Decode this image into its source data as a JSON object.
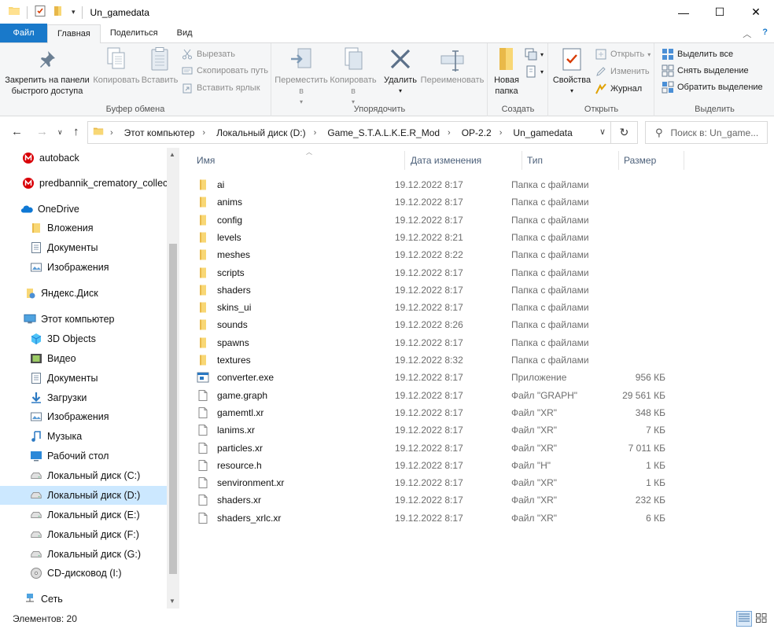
{
  "window": {
    "title": "Un_gamedata",
    "minimize": "—",
    "maximize": "☐",
    "close": "✕"
  },
  "tabs": {
    "file": "Файл",
    "home": "Главная",
    "share": "Поделиться",
    "view": "Вид"
  },
  "ribbon": {
    "clipboard": {
      "pin": "Закрепить на панели быстрого доступа",
      "copy": "Копировать",
      "paste": "Вставить",
      "cut": "Вырезать",
      "copy_path": "Скопировать путь",
      "paste_shortcut": "Вставить ярлык",
      "label": "Буфер обмена"
    },
    "organize": {
      "move": "Переместить в",
      "copy_to": "Копировать в",
      "delete": "Удалить",
      "rename": "Переименовать",
      "label": "Упорядочить"
    },
    "new": {
      "new_folder": "Новая папка",
      "label": "Создать"
    },
    "open": {
      "properties": "Свойства",
      "open": "Открыть",
      "edit": "Изменить",
      "history": "Журнал",
      "label": "Открыть"
    },
    "select": {
      "select_all": "Выделить все",
      "select_none": "Снять выделение",
      "invert": "Обратить выделение",
      "label": "Выделить"
    }
  },
  "address": {
    "crumbs": [
      "Этот компьютер",
      "Локальный диск (D:)",
      "Game_S.T.A.L.K.E.R_Mod",
      "OP-2.2",
      "Un_gamedata"
    ],
    "search_placeholder": "Поиск в: Un_game..."
  },
  "nav": {
    "items": [
      {
        "label": "autoback",
        "icon": "mega-icon"
      },
      {
        "label": "predbannik_crematory_collect",
        "icon": "mega-icon"
      },
      {
        "label": "OneDrive",
        "icon": "onedrive-icon"
      },
      {
        "label": "Вложения",
        "icon": "folder-icon"
      },
      {
        "label": "Документы",
        "icon": "documents-icon"
      },
      {
        "label": "Изображения",
        "icon": "pictures-icon"
      },
      {
        "label": "Яндекс.Диск",
        "icon": "yandex-disk-icon"
      },
      {
        "label": "Этот компьютер",
        "icon": "computer-icon"
      },
      {
        "label": "3D Objects",
        "icon": "3d-objects-icon"
      },
      {
        "label": "Видео",
        "icon": "video-icon"
      },
      {
        "label": "Документы",
        "icon": "documents-icon"
      },
      {
        "label": "Загрузки",
        "icon": "downloads-icon"
      },
      {
        "label": "Изображения",
        "icon": "pictures-icon"
      },
      {
        "label": "Музыка",
        "icon": "music-icon"
      },
      {
        "label": "Рабочий стол",
        "icon": "desktop-icon"
      },
      {
        "label": "Локальный диск (C:)",
        "icon": "drive-icon"
      },
      {
        "label": "Локальный диск (D:)",
        "icon": "drive-icon"
      },
      {
        "label": "Локальный диск (E:)",
        "icon": "drive-icon"
      },
      {
        "label": "Локальный диск (F:)",
        "icon": "drive-icon"
      },
      {
        "label": "Локальный диск (G:)",
        "icon": "drive-icon"
      },
      {
        "label": "CD-дисковод (I:)",
        "icon": "cd-drive-icon"
      },
      {
        "label": "Сеть",
        "icon": "network-icon"
      }
    ],
    "selected_index": 16
  },
  "columns": {
    "name": "Имя",
    "date": "Дата изменения",
    "type": "Тип",
    "size": "Размер"
  },
  "files": [
    {
      "name": "ai",
      "date": "19.12.2022 8:17",
      "type": "Папка с файлами",
      "size": "",
      "icon": "folder"
    },
    {
      "name": "anims",
      "date": "19.12.2022 8:17",
      "type": "Папка с файлами",
      "size": "",
      "icon": "folder"
    },
    {
      "name": "config",
      "date": "19.12.2022 8:17",
      "type": "Папка с файлами",
      "size": "",
      "icon": "folder"
    },
    {
      "name": "levels",
      "date": "19.12.2022 8:21",
      "type": "Папка с файлами",
      "size": "",
      "icon": "folder"
    },
    {
      "name": "meshes",
      "date": "19.12.2022 8:22",
      "type": "Папка с файлами",
      "size": "",
      "icon": "folder"
    },
    {
      "name": "scripts",
      "date": "19.12.2022 8:17",
      "type": "Папка с файлами",
      "size": "",
      "icon": "folder"
    },
    {
      "name": "shaders",
      "date": "19.12.2022 8:17",
      "type": "Папка с файлами",
      "size": "",
      "icon": "folder"
    },
    {
      "name": "skins_ui",
      "date": "19.12.2022 8:17",
      "type": "Папка с файлами",
      "size": "",
      "icon": "folder"
    },
    {
      "name": "sounds",
      "date": "19.12.2022 8:26",
      "type": "Папка с файлами",
      "size": "",
      "icon": "folder"
    },
    {
      "name": "spawns",
      "date": "19.12.2022 8:17",
      "type": "Папка с файлами",
      "size": "",
      "icon": "folder"
    },
    {
      "name": "textures",
      "date": "19.12.2022 8:32",
      "type": "Папка с файлами",
      "size": "",
      "icon": "folder"
    },
    {
      "name": "converter.exe",
      "date": "19.12.2022 8:17",
      "type": "Приложение",
      "size": "956 КБ",
      "icon": "exe"
    },
    {
      "name": "game.graph",
      "date": "19.12.2022 8:17",
      "type": "Файл \"GRAPH\"",
      "size": "29 561 КБ",
      "icon": "file"
    },
    {
      "name": "gamemtl.xr",
      "date": "19.12.2022 8:17",
      "type": "Файл \"XR\"",
      "size": "348 КБ",
      "icon": "file"
    },
    {
      "name": "lanims.xr",
      "date": "19.12.2022 8:17",
      "type": "Файл \"XR\"",
      "size": "7 КБ",
      "icon": "file"
    },
    {
      "name": "particles.xr",
      "date": "19.12.2022 8:17",
      "type": "Файл \"XR\"",
      "size": "7 011 КБ",
      "icon": "file"
    },
    {
      "name": "resource.h",
      "date": "19.12.2022 8:17",
      "type": "Файл \"H\"",
      "size": "1 КБ",
      "icon": "file"
    },
    {
      "name": "senvironment.xr",
      "date": "19.12.2022 8:17",
      "type": "Файл \"XR\"",
      "size": "1 КБ",
      "icon": "file"
    },
    {
      "name": "shaders.xr",
      "date": "19.12.2022 8:17",
      "type": "Файл \"XR\"",
      "size": "232 КБ",
      "icon": "file"
    },
    {
      "name": "shaders_xrlc.xr",
      "date": "19.12.2022 8:17",
      "type": "Файл \"XR\"",
      "size": "6 КБ",
      "icon": "file"
    }
  ],
  "status": {
    "count": "Элементов: 20"
  },
  "colors": {
    "accent": "#1979ca",
    "folder": "#f8d775",
    "selection": "#cce8ff"
  }
}
